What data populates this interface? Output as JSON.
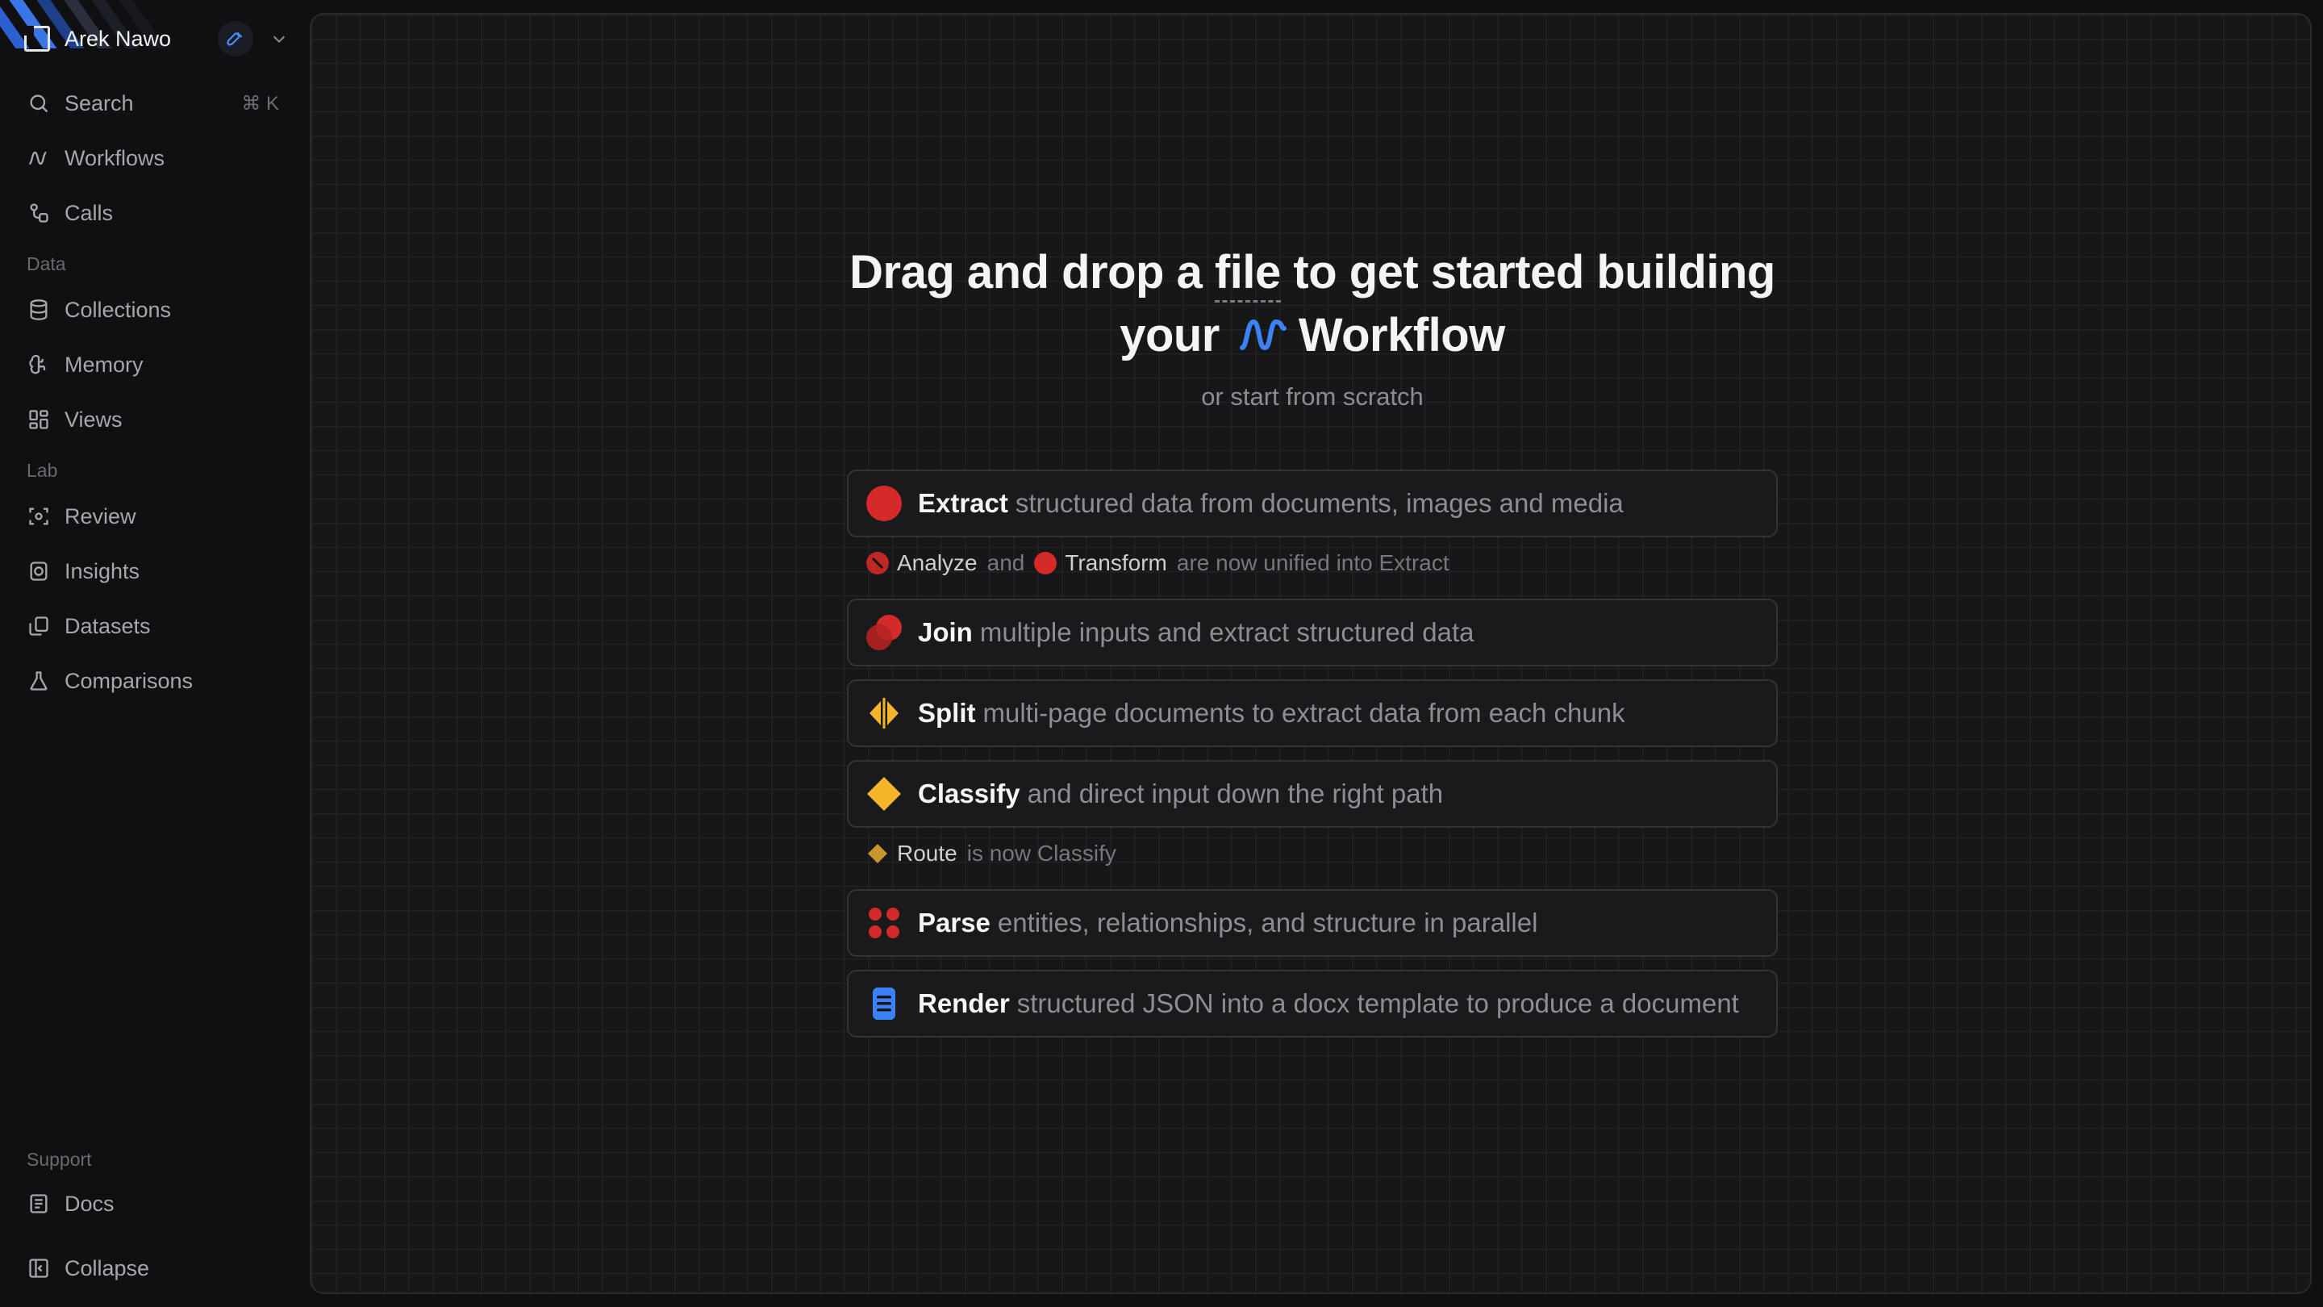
{
  "account": {
    "name": "Arek Nawo"
  },
  "colors": {
    "red": "#d42a2a",
    "yellow": "#f5b52a",
    "blue": "#3b82f6"
  },
  "nav": {
    "search": {
      "label": "Search",
      "shortcut": "⌘ K",
      "icon": "search-icon"
    },
    "workflows": {
      "label": "Workflows",
      "icon": "workflow-icon"
    },
    "calls": {
      "label": "Calls",
      "icon": "calls-icon"
    },
    "data_section": "Data",
    "collections": {
      "label": "Collections",
      "icon": "database-icon"
    },
    "memory": {
      "label": "Memory",
      "icon": "brain-icon"
    },
    "views": {
      "label": "Views",
      "icon": "grid-icon"
    },
    "lab_section": "Lab",
    "review": {
      "label": "Review",
      "icon": "review-icon"
    },
    "insights": {
      "label": "Insights",
      "icon": "insights-icon"
    },
    "datasets": {
      "label": "Datasets",
      "icon": "datasets-icon"
    },
    "comparisons": {
      "label": "Comparisons",
      "icon": "flask-icon"
    },
    "support_section": "Support",
    "docs": {
      "label": "Docs",
      "icon": "docs-icon"
    },
    "collapse": {
      "label": "Collapse",
      "icon": "collapse-icon"
    }
  },
  "hero": {
    "line1_pre": "Drag and drop a ",
    "line1_file": "file",
    "line1_post": " to get started building",
    "line2_pre": "your",
    "line2_post": "Workflow",
    "subtitle": "or start from scratch"
  },
  "options": [
    {
      "title": "Extract",
      "desc": "structured data from documents, images and media",
      "icon": "extract-icon"
    },
    {
      "title": "Join",
      "desc": "multiple inputs and extract structured data",
      "icon": "join-icon"
    },
    {
      "title": "Split",
      "desc": "multi-page documents to extract data from each chunk",
      "icon": "split-icon"
    },
    {
      "title": "Classify",
      "desc": "and direct input down the right path",
      "icon": "classify-icon"
    },
    {
      "title": "Parse",
      "desc": "entities, relationships, and structure in parallel",
      "icon": "parse-icon"
    },
    {
      "title": "Render",
      "desc": "structured JSON into a docx template to produce a document",
      "icon": "render-icon"
    }
  ],
  "notes": {
    "extract": {
      "a": "Analyze",
      "and": "and",
      "b": "Transform",
      "tail": "are now unified into Extract"
    },
    "classify": {
      "a": "Route",
      "tail": "is now Classify"
    }
  }
}
